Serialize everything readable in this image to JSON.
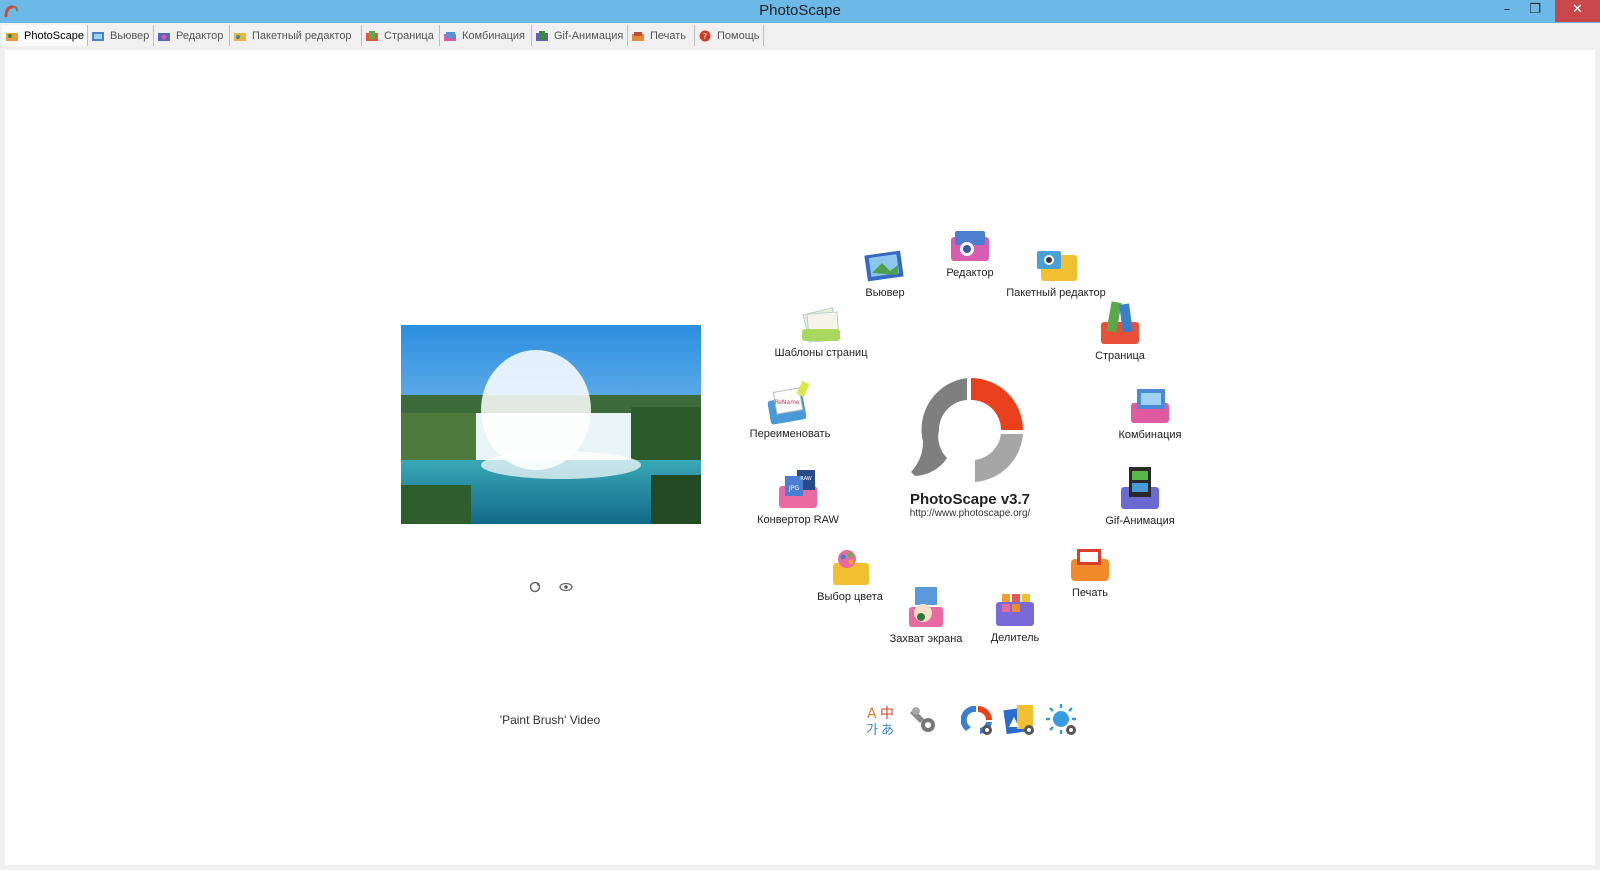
{
  "window": {
    "title": "PhotoScape",
    "minimize": "–",
    "maximize": "❐",
    "close": "✕"
  },
  "tabs": [
    {
      "label": "PhotoScape",
      "icon": "photoscape-icon"
    },
    {
      "label": "Вьювер",
      "icon": "viewer-icon"
    },
    {
      "label": "Редактор",
      "icon": "editor-icon"
    },
    {
      "label": "Пакетный редактор",
      "icon": "batch-editor-icon"
    },
    {
      "label": "Страница",
      "icon": "page-icon"
    },
    {
      "label": "Комбинация",
      "icon": "combine-icon"
    },
    {
      "label": "Gif-Анимация",
      "icon": "gif-animation-icon"
    },
    {
      "label": "Печать",
      "icon": "print-icon"
    },
    {
      "label": "Помощь",
      "icon": "help-icon"
    }
  ],
  "wheel": {
    "viewer": "Вьювер",
    "editor": "Редактор",
    "batch": "Пакетный редактор",
    "page": "Страница",
    "combine": "Комбинация",
    "gif": "Gif-Анимация",
    "print": "Печать",
    "splitter": "Делитель",
    "screen_capture": "Захват экрана",
    "color_picker": "Выбор цвета",
    "raw": "Конвертор RAW",
    "rename": "Переименовать",
    "templates": "Шаблоны страниц"
  },
  "logo": {
    "name": "PhotoScape v3.7",
    "url": "http://www.photoscape.org/"
  },
  "preview": {
    "caption": "'Paint Brush' Video"
  },
  "colors": {
    "titlebar": "#6cb8e6",
    "close": "#c7474a",
    "logo_red": "#e8401c",
    "logo_gray": "#7f7f7f"
  }
}
